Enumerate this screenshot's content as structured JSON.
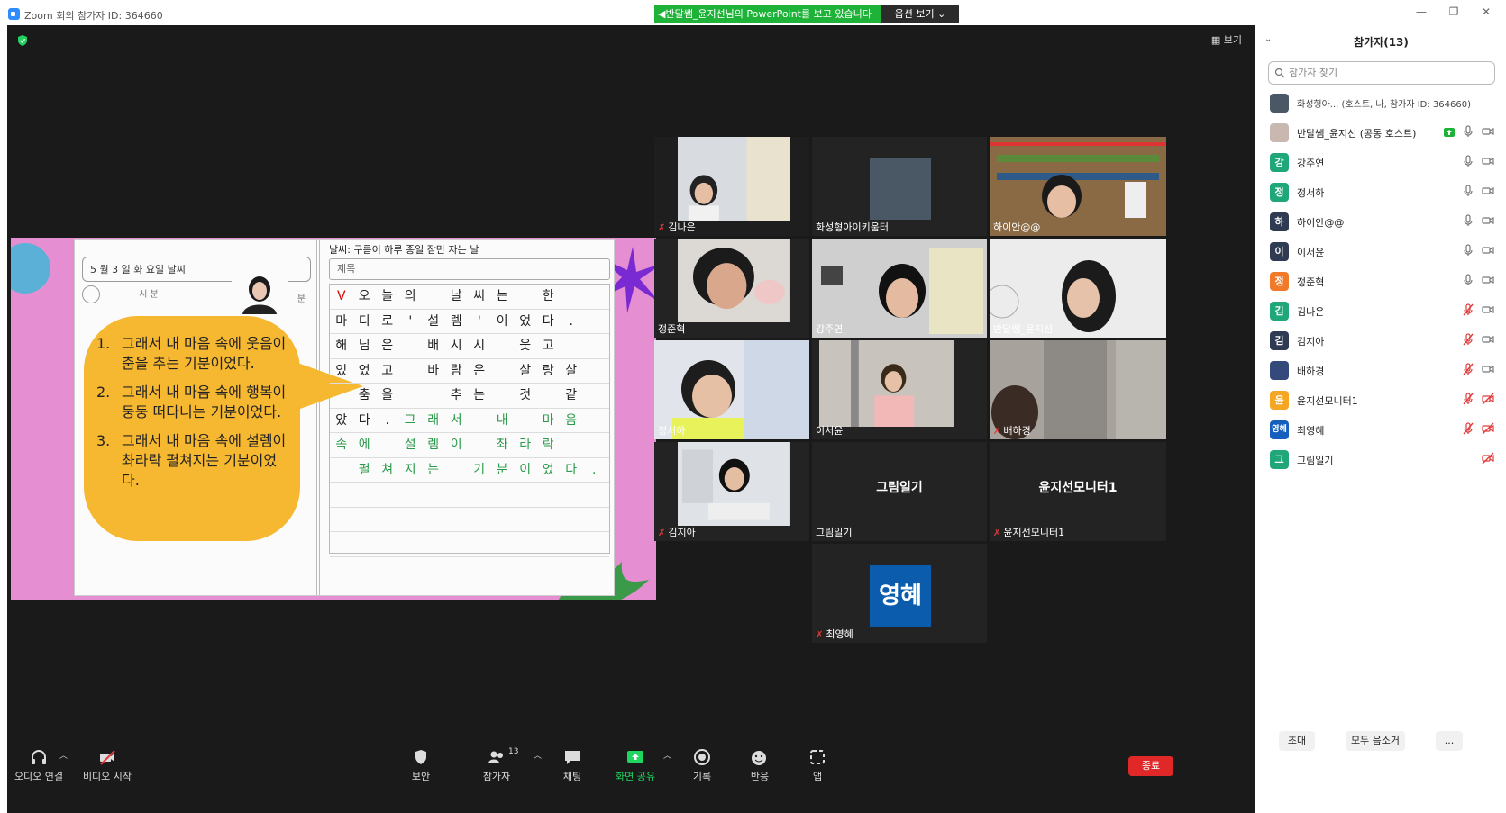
{
  "window": {
    "title": "Zoom 회의 참가자 ID: 364660",
    "share_banner": "◀반달쌤_윤지선님의 PowerPoint를 보고 있습니다",
    "view_options": "옵션 보기 ⌄",
    "gallery_label": "보기"
  },
  "slide": {
    "date_row": "5 월  3  일  화  요일   날씨",
    "clock_row_left": "시         분",
    "clock_row_right": "분",
    "weather": "날씨:  구름이 하루 종일 잠만 자는 날",
    "title_placeholder": "제목",
    "bubble_items": [
      {
        "num": "1.",
        "text": "그래서 내 마음 속에 웃음이 춤을 추는 기분이었다."
      },
      {
        "num": "2.",
        "text": "그래서 내 마음 속에 행복이 둥둥 떠다니는 기분이었다."
      },
      {
        "num": "3.",
        "text": "그래서 내 마음 속에 설렘이 촤라락 펼쳐지는 기분이었다."
      }
    ],
    "grid_rows": [
      [
        {
          "t": "V",
          "c": "red"
        },
        {
          "t": "오"
        },
        {
          "t": "늘"
        },
        {
          "t": "의"
        },
        {
          "t": ""
        },
        {
          "t": "날"
        },
        {
          "t": "씨"
        },
        {
          "t": "는"
        },
        {
          "t": ""
        },
        {
          "t": "한"
        },
        {
          "t": ""
        },
        {
          "t": ""
        }
      ],
      [
        {
          "t": "마"
        },
        {
          "t": "디"
        },
        {
          "t": "로"
        },
        {
          "t": "'"
        },
        {
          "t": "설"
        },
        {
          "t": "렘"
        },
        {
          "t": "'"
        },
        {
          "t": "이"
        },
        {
          "t": "었"
        },
        {
          "t": "다"
        },
        {
          "t": "."
        },
        {
          "t": ""
        }
      ],
      [
        {
          "t": "해"
        },
        {
          "t": "님"
        },
        {
          "t": "은"
        },
        {
          "t": ""
        },
        {
          "t": "배"
        },
        {
          "t": "시"
        },
        {
          "t": "시"
        },
        {
          "t": ""
        },
        {
          "t": "웃"
        },
        {
          "t": "고"
        },
        {
          "t": ""
        },
        {
          "t": ""
        }
      ],
      [
        {
          "t": "있"
        },
        {
          "t": "었"
        },
        {
          "t": "고"
        },
        {
          "t": ""
        },
        {
          "t": "바"
        },
        {
          "t": "람"
        },
        {
          "t": "은"
        },
        {
          "t": ""
        },
        {
          "t": "살"
        },
        {
          "t": "랑"
        },
        {
          "t": "살"
        },
        {
          "t": ""
        }
      ],
      [
        {
          "t": ""
        },
        {
          "t": "춤"
        },
        {
          "t": "을"
        },
        {
          "t": ""
        },
        {
          "t": ""
        },
        {
          "t": "추"
        },
        {
          "t": "는"
        },
        {
          "t": ""
        },
        {
          "t": "것"
        },
        {
          "t": ""
        },
        {
          "t": "같"
        },
        {
          "t": ""
        }
      ],
      [
        {
          "t": "았"
        },
        {
          "t": "다"
        },
        {
          "t": "."
        },
        {
          "t": "그",
          "c": "green"
        },
        {
          "t": "래",
          "c": "green"
        },
        {
          "t": "서",
          "c": "green"
        },
        {
          "t": ""
        },
        {
          "t": "내",
          "c": "green"
        },
        {
          "t": ""
        },
        {
          "t": "마",
          "c": "green"
        },
        {
          "t": "음",
          "c": "green"
        },
        {
          "t": ""
        }
      ],
      [
        {
          "t": "속",
          "c": "green"
        },
        {
          "t": "에",
          "c": "green"
        },
        {
          "t": ""
        },
        {
          "t": "설",
          "c": "green"
        },
        {
          "t": "렘",
          "c": "green"
        },
        {
          "t": "이",
          "c": "green"
        },
        {
          "t": ""
        },
        {
          "t": "촤",
          "c": "green"
        },
        {
          "t": "라",
          "c": "green"
        },
        {
          "t": "락",
          "c": "green"
        },
        {
          "t": ""
        },
        {
          "t": ""
        }
      ],
      [
        {
          "t": ""
        },
        {
          "t": "펼",
          "c": "green"
        },
        {
          "t": "쳐",
          "c": "green"
        },
        {
          "t": "지",
          "c": "green"
        },
        {
          "t": "는",
          "c": "green"
        },
        {
          "t": ""
        },
        {
          "t": "기",
          "c": "green"
        },
        {
          "t": "분",
          "c": "green"
        },
        {
          "t": "이",
          "c": "green"
        },
        {
          "t": "었",
          "c": "green"
        },
        {
          "t": "다",
          "c": "green"
        },
        {
          "t": ".",
          "c": "green"
        }
      ],
      [],
      [],
      []
    ]
  },
  "tiles": [
    {
      "name": "김나은",
      "muted": true
    },
    {
      "name": "화성형아이키움터",
      "muted": false
    },
    {
      "name": "하이안@@",
      "muted": false
    },
    {
      "name": "정준혁",
      "muted": false
    },
    {
      "name": "강주연",
      "muted": false
    },
    {
      "name": "반달쌤_윤지선",
      "muted": false
    },
    {
      "name": "정서하",
      "muted": false
    },
    {
      "name": "이서윤",
      "muted": false
    },
    {
      "name": "배하경",
      "muted": true
    },
    {
      "name": "김지아",
      "muted": true
    },
    {
      "name": "그림일기",
      "muted": false,
      "big": "그림일기"
    },
    {
      "name": "윤지선모니터1",
      "muted": true,
      "big": "윤지선모니터1"
    },
    {
      "name": "최영혜",
      "muted": true,
      "avatar": "영혜"
    }
  ],
  "toolbar": {
    "audio": "오디오 연결",
    "video": "비디오 시작",
    "security": "보안",
    "participants": "참가자",
    "participants_count": "13",
    "chat": "채팅",
    "share": "화면 공유",
    "record": "기록",
    "reactions": "반응",
    "apps": "앱",
    "end": "종료"
  },
  "panel": {
    "title": "참가자(13)",
    "search_placeholder": "참가자 찾기",
    "participants": [
      {
        "name": "화성형아...  (호스트, 나, 참가자 ID: 364660)",
        "initial": "",
        "color": "#4a5866",
        "mic": "none",
        "cam": "none"
      },
      {
        "name": "반달쌤_윤지선 (공동 호스트)",
        "initial": "",
        "color": "#c9b8b0",
        "mic": "on",
        "cam": "on",
        "share": true
      },
      {
        "name": "강주연",
        "initial": "강",
        "color": "#1fa77a",
        "mic": "on",
        "cam": "on"
      },
      {
        "name": "정서하",
        "initial": "정",
        "color": "#1fa77a",
        "mic": "on",
        "cam": "on"
      },
      {
        "name": "하이안@@",
        "initial": "하",
        "color": "#2f3b52",
        "mic": "on",
        "cam": "on"
      },
      {
        "name": "이서윤",
        "initial": "이",
        "color": "#2f3b52",
        "mic": "on",
        "cam": "on"
      },
      {
        "name": "정준혁",
        "initial": "정",
        "color": "#f07a2a",
        "mic": "on",
        "cam": "on"
      },
      {
        "name": "김나은",
        "initial": "김",
        "color": "#1fa77a",
        "mic": "off",
        "cam": "on"
      },
      {
        "name": "김지아",
        "initial": "김",
        "color": "#2f3b52",
        "mic": "off",
        "cam": "on"
      },
      {
        "name": "배하경",
        "initial": "",
        "color": "#334a7a",
        "mic": "off",
        "cam": "on"
      },
      {
        "name": "윤지선모니터1",
        "initial": "윤",
        "color": "#f5a623",
        "mic": "off",
        "cam": "off"
      },
      {
        "name": "최영혜",
        "initial": "영혜",
        "color": "#1560bd",
        "mic": "off",
        "cam": "off"
      },
      {
        "name": "그림일기",
        "initial": "그",
        "color": "#1fa77a",
        "mic": "none",
        "cam": "off"
      }
    ],
    "invite": "초대",
    "mute_all": "모두 음소거",
    "more": "..."
  }
}
